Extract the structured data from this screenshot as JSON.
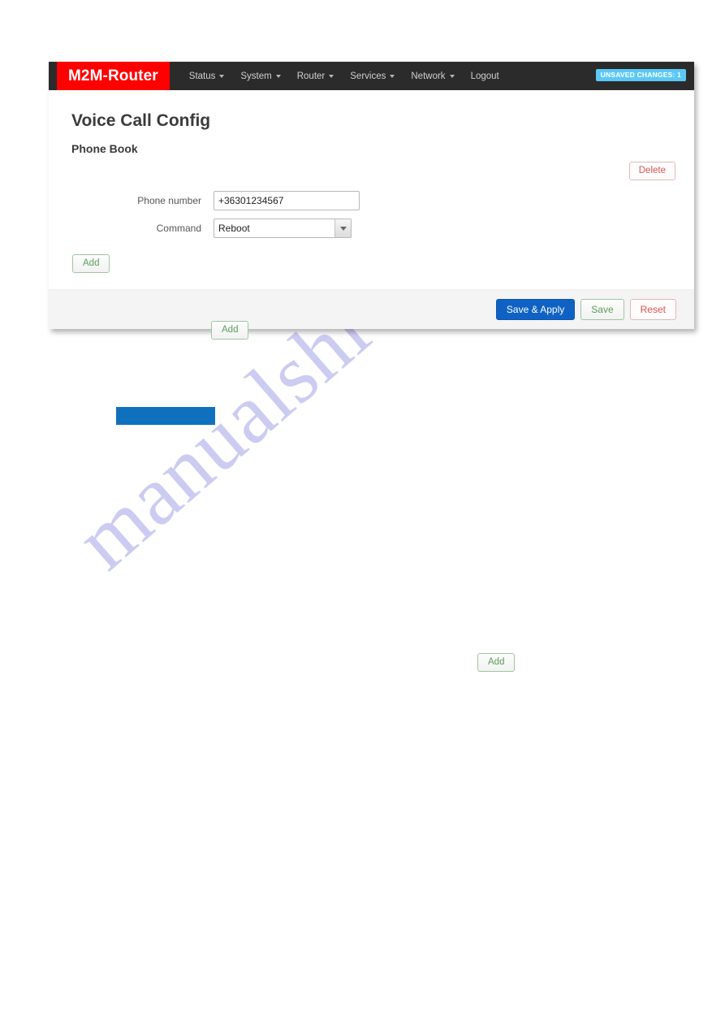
{
  "navbar": {
    "brand": "M2M-Router",
    "menu_items": [
      {
        "label": "Status",
        "has_caret": true
      },
      {
        "label": "System",
        "has_caret": true
      },
      {
        "label": "Router",
        "has_caret": true
      },
      {
        "label": "Services",
        "has_caret": true
      },
      {
        "label": "Network",
        "has_caret": true
      },
      {
        "label": "Logout",
        "has_caret": false
      }
    ],
    "unsaved_badge": "UNSAVED CHANGES: 1",
    "brand_color": "#ff0000",
    "bar_color": "#2b2b2b",
    "badge_color": "#5bc8f5"
  },
  "page": {
    "title": "Voice Call Config",
    "section_title": "Phone Book"
  },
  "entry": {
    "delete_label": "Delete",
    "phone_number_label": "Phone number",
    "phone_number_value": "+36301234567",
    "phone_number_placeholder": "",
    "command_label": "Command",
    "command_value": "Reboot",
    "command_options": [
      "Reboot"
    ]
  },
  "actions": {
    "add_label": "Add",
    "save_apply_label": "Save & Apply",
    "save_label": "Save",
    "reset_label": "Reset"
  },
  "stray": {
    "add_label_1": "Add",
    "add_label_2": "Add",
    "blue_block_color": "#0f71bd"
  },
  "watermark": {
    "text": "manualshive.com",
    "color": "#ccccf2"
  }
}
